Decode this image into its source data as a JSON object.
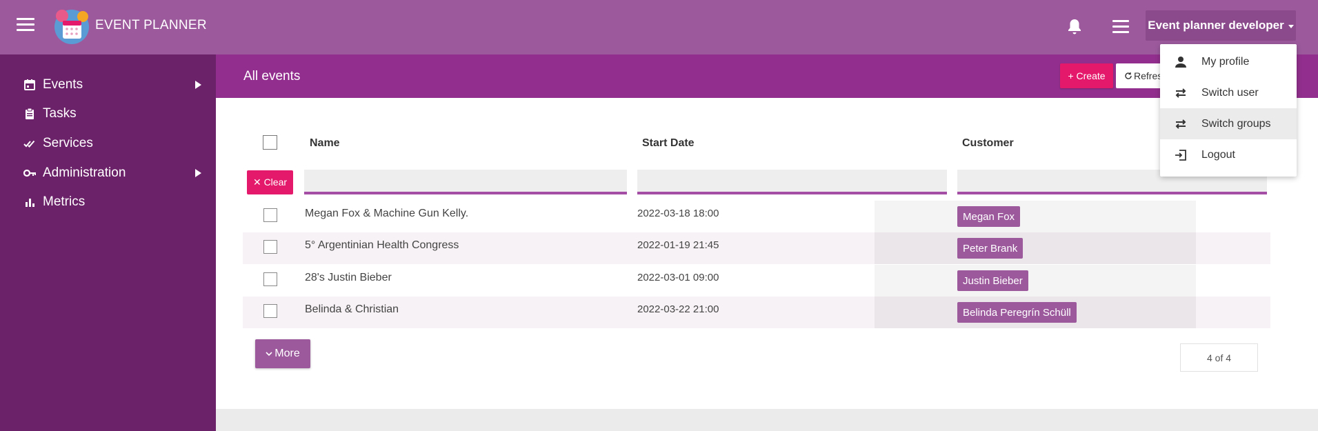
{
  "app": {
    "brand": "EVENT PLANNER"
  },
  "topbar": {
    "user_label": "Event planner developer"
  },
  "sidebar": {
    "items": [
      {
        "label": "Events",
        "has_submenu": true,
        "icon": "calendar-icon"
      },
      {
        "label": "Tasks",
        "has_submenu": false,
        "icon": "clipboard-icon"
      },
      {
        "label": "Services",
        "has_submenu": false,
        "icon": "double-check-icon"
      },
      {
        "label": "Administration",
        "has_submenu": true,
        "icon": "key-icon"
      },
      {
        "label": "Metrics",
        "has_submenu": false,
        "icon": "bar-chart-icon"
      }
    ]
  },
  "main": {
    "title": "All events",
    "create_label": "+ Create",
    "refresh_label": "Refresh",
    "clear_label": "✕ Clear",
    "more_label": "More",
    "paging": "4 of 4"
  },
  "table": {
    "columns": [
      "Name",
      "Start Date",
      "Customer"
    ],
    "rows": [
      {
        "name": "Megan Fox & Machine Gun Kelly.",
        "date": "2022-03-18 18:00",
        "customer": "Megan Fox"
      },
      {
        "name": "5° Argentinian Health Congress",
        "date": "2022-01-19 21:45",
        "customer": "Peter Brank"
      },
      {
        "name": "28's Justin Bieber",
        "date": "2022-03-01 09:00",
        "customer": "Justin Bieber"
      },
      {
        "name": "Belinda & Christian",
        "date": "2022-03-22 21:00",
        "customer": "Belinda Peregrín Schüll"
      }
    ]
  },
  "dropdown": {
    "items": [
      {
        "label": "My profile",
        "icon": "person-icon"
      },
      {
        "label": "Switch user",
        "icon": "swap-icon"
      },
      {
        "label": "Switch groups",
        "icon": "swap-icon",
        "active": true
      },
      {
        "label": "Logout",
        "icon": "logout-icon"
      }
    ]
  },
  "colors": {
    "topbar": "#9c5a9d",
    "sidebar": "#6c2269",
    "header_strip": "#922f8e",
    "accent": "#e4196b",
    "tag": "#9c5a9d"
  }
}
